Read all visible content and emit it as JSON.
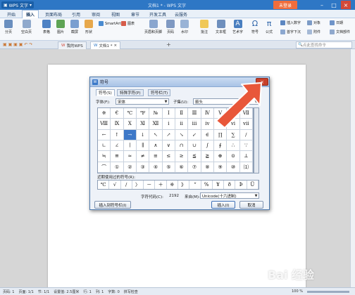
{
  "titlebar": {
    "app": "WPS 文字",
    "doc_title": "文档1 * - WPS 文字",
    "login": "未登录"
  },
  "menu": {
    "tabs": [
      "开始",
      "插入",
      "页面布局",
      "引用",
      "审阅",
      "视图",
      "章节",
      "开发工具",
      "云服务"
    ],
    "active": "插入"
  },
  "ribbon": {
    "items": [
      "分页",
      "空白页",
      "表格",
      "图片",
      "截屏",
      "形状",
      "SmartArt",
      "图表",
      "页眉和页脚",
      "页码",
      "水印",
      "批注",
      "文本框",
      "艺术字",
      "符号",
      "公式"
    ],
    "right_items": [
      "插入数字",
      "对象",
      "日期",
      "首字下沉",
      "附件",
      "文档部件"
    ]
  },
  "doctabs": {
    "tabs": [
      "我的WPS",
      "文档1 *"
    ],
    "search_placeholder": "点此查找命令"
  },
  "dialog": {
    "title": "符号",
    "tabs": [
      "符号(S)",
      "特殊字符(P)",
      "符号栏(T)"
    ],
    "font_label": "字体(F):",
    "font_value": "宋体",
    "subset_label": "子集(U):",
    "subset_value": "箭头",
    "grid": [
      [
        "※",
        "€",
        "℃",
        "℉",
        "№",
        "Ⅰ",
        "Ⅱ",
        "Ⅲ",
        "Ⅳ",
        "Ⅴ",
        "Ⅵ",
        "Ⅶ"
      ],
      [
        "Ⅷ",
        "Ⅸ",
        "Ⅹ",
        "Ⅺ",
        "Ⅻ",
        "ⅰ",
        "ⅱ",
        "ⅲ",
        "ⅳ",
        "ⅴ",
        "ⅵ",
        "ⅶ"
      ],
      [
        "←",
        "↑",
        "→",
        "↓",
        "↖",
        "↗",
        "↘",
        "↙",
        "∈",
        "∏",
        "∑",
        "∕"
      ],
      [
        "∟",
        "∠",
        "∣",
        "∥",
        "∧",
        "∨",
        "∩",
        "∪",
        "∫",
        "∮",
        "∴",
        "∵"
      ],
      [
        "≒",
        "≌",
        "≈",
        "≠",
        "≡",
        "≤",
        "≥",
        "≦",
        "≧",
        "⊕",
        "⊙",
        "⊥"
      ],
      [
        "⌒",
        "①",
        "②",
        "③",
        "④",
        "⑤",
        "⑥",
        "⑦",
        "⑧",
        "⑨",
        "⑩",
        "⑴"
      ]
    ],
    "selected_index": 26,
    "recent_label": "近期使用过的符号(R):",
    "recent": [
      "℃",
      "√",
      "∕",
      "〉",
      "－",
      "＋",
      "※",
      "》",
      "“",
      "%",
      "¥",
      "ð",
      "Þ",
      "Ü"
    ],
    "code_label": "字符代码(C):",
    "code_value": "2192",
    "from_label": "来自(M):",
    "from_value": "Unicode(十六进制)",
    "insert_to_bar": "插入到符号栏(I)",
    "insert": "插入(I)",
    "cancel": "取消"
  },
  "statusbar": {
    "items": [
      "页码: 1",
      "页面: 1/1",
      "节: 1/1",
      "设置值: 2.5厘米",
      "行: 1",
      "列: 1",
      "字数: 0",
      "拼写检查"
    ],
    "zoom": "100 %"
  },
  "watermark": "Bai 经验",
  "colors": {
    "title_blue": "#2e77c5",
    "login_orange": "#f06d3c",
    "arrow_orange": "#e8573a",
    "select_blue": "#3d78c8"
  }
}
